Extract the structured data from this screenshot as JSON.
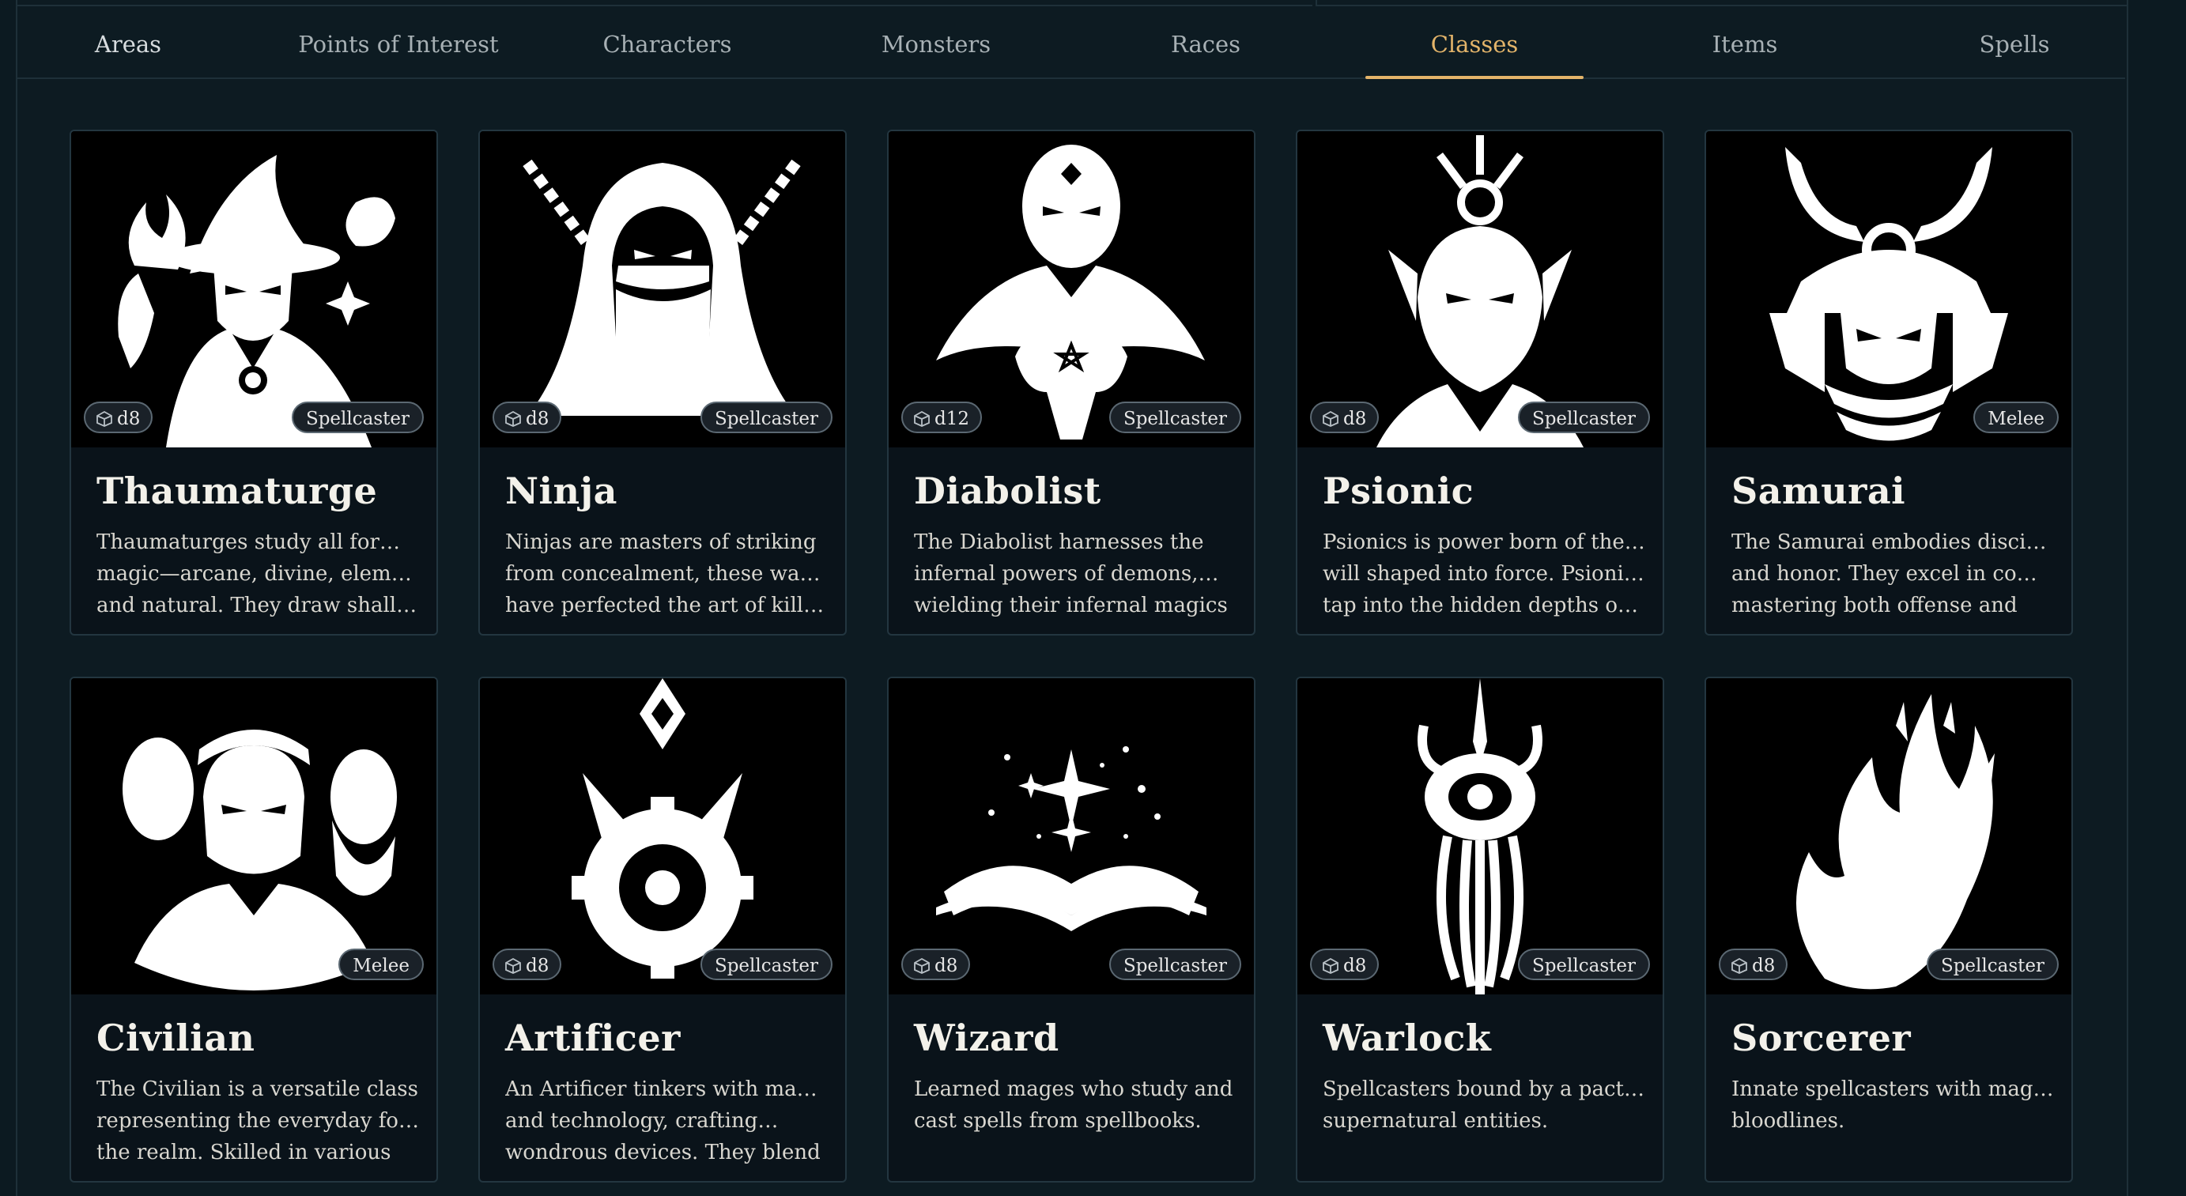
{
  "nav": {
    "tabs": [
      "Areas",
      "Points of Interest",
      "Characters",
      "Monsters",
      "Races",
      "Classes",
      "Items",
      "Spells"
    ],
    "active": "Classes"
  },
  "colors": {
    "accent": "#e3b46a",
    "background": "#0c1a21",
    "card": "#0a131a"
  },
  "classes": [
    {
      "name": "Thaumaturge",
      "die": "d8",
      "role": "Spellcaster",
      "icon": "wizard-mage-icon",
      "lines": [
        "Thaumaturges study all forms of",
        "magic—arcane, divine, element…",
        "and natural. They draw shallow"
      ]
    },
    {
      "name": "Ninja",
      "die": "d8",
      "role": "Spellcaster",
      "icon": "hooded-ninja-icon",
      "lines": [
        "Ninjas are masters of striking",
        "from concealment, these warrio…",
        "have perfected the art of killing"
      ]
    },
    {
      "name": "Diabolist",
      "die": "d12",
      "role": "Spellcaster",
      "icon": "demon-summoner-icon",
      "lines": [
        "The Diabolist harnesses the",
        "infernal powers of demons,…",
        "wielding their infernal magics"
      ]
    },
    {
      "name": "Psionic",
      "die": "d8",
      "role": "Spellcaster",
      "icon": "psionic-mind-icon",
      "lines": [
        "Psionics is power born of the self,",
        "will shaped into force. Psionics…",
        "tap into the hidden depths of the"
      ]
    },
    {
      "name": "Samurai",
      "die": "",
      "role": "Melee",
      "icon": "samurai-helmet-icon",
      "lines": [
        "The Samurai embodies discipline,",
        "and honor. They excel in comba…",
        "mastering both offense and"
      ]
    },
    {
      "name": "Civilian",
      "die": "",
      "role": "Melee",
      "icon": "townsfolk-group-icon",
      "lines": [
        "The Civilian is a versatile class",
        "representing the everyday folk o…",
        "the realm. Skilled in various"
      ]
    },
    {
      "name": "Artificer",
      "die": "d8",
      "role": "Spellcaster",
      "icon": "gear-crystal-icon",
      "lines": [
        "An Artificer tinkers with magic",
        "and technology, crafting…",
        "wondrous devices. They blend"
      ]
    },
    {
      "name": "Wizard",
      "die": "d8",
      "role": "Spellcaster",
      "icon": "open-spellbook-icon",
      "lines": [
        "Learned mages who study and",
        "cast spells from spellbooks.",
        ""
      ]
    },
    {
      "name": "Warlock",
      "die": "d8",
      "role": "Spellcaster",
      "icon": "eldritch-eye-icon",
      "lines": [
        "Spellcasters bound by a pact to",
        "supernatural entities.",
        ""
      ]
    },
    {
      "name": "Sorcerer",
      "die": "d8",
      "role": "Spellcaster",
      "icon": "flame-icon",
      "lines": [
        "Innate spellcasters with magical",
        "bloodlines.",
        ""
      ]
    }
  ]
}
